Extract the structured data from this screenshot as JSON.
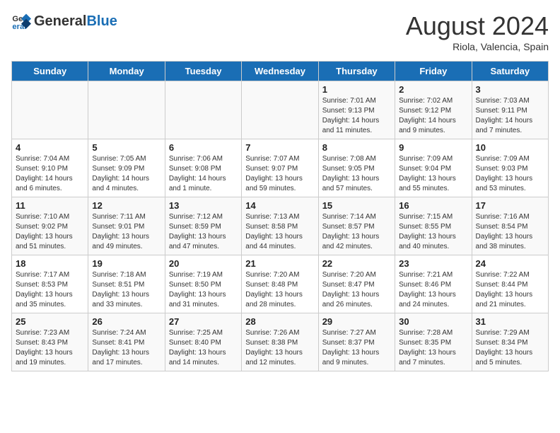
{
  "header": {
    "logo_general": "General",
    "logo_blue": "Blue",
    "month": "August 2024",
    "location": "Riola, Valencia, Spain"
  },
  "weekdays": [
    "Sunday",
    "Monday",
    "Tuesday",
    "Wednesday",
    "Thursday",
    "Friday",
    "Saturday"
  ],
  "weeks": [
    [
      {
        "day": "",
        "info": ""
      },
      {
        "day": "",
        "info": ""
      },
      {
        "day": "",
        "info": ""
      },
      {
        "day": "",
        "info": ""
      },
      {
        "day": "1",
        "info": "Sunrise: 7:01 AM\nSunset: 9:13 PM\nDaylight: 14 hours\nand 11 minutes."
      },
      {
        "day": "2",
        "info": "Sunrise: 7:02 AM\nSunset: 9:12 PM\nDaylight: 14 hours\nand 9 minutes."
      },
      {
        "day": "3",
        "info": "Sunrise: 7:03 AM\nSunset: 9:11 PM\nDaylight: 14 hours\nand 7 minutes."
      }
    ],
    [
      {
        "day": "4",
        "info": "Sunrise: 7:04 AM\nSunset: 9:10 PM\nDaylight: 14 hours\nand 6 minutes."
      },
      {
        "day": "5",
        "info": "Sunrise: 7:05 AM\nSunset: 9:09 PM\nDaylight: 14 hours\nand 4 minutes."
      },
      {
        "day": "6",
        "info": "Sunrise: 7:06 AM\nSunset: 9:08 PM\nDaylight: 14 hours\nand 1 minute."
      },
      {
        "day": "7",
        "info": "Sunrise: 7:07 AM\nSunset: 9:07 PM\nDaylight: 13 hours\nand 59 minutes."
      },
      {
        "day": "8",
        "info": "Sunrise: 7:08 AM\nSunset: 9:05 PM\nDaylight: 13 hours\nand 57 minutes."
      },
      {
        "day": "9",
        "info": "Sunrise: 7:09 AM\nSunset: 9:04 PM\nDaylight: 13 hours\nand 55 minutes."
      },
      {
        "day": "10",
        "info": "Sunrise: 7:09 AM\nSunset: 9:03 PM\nDaylight: 13 hours\nand 53 minutes."
      }
    ],
    [
      {
        "day": "11",
        "info": "Sunrise: 7:10 AM\nSunset: 9:02 PM\nDaylight: 13 hours\nand 51 minutes."
      },
      {
        "day": "12",
        "info": "Sunrise: 7:11 AM\nSunset: 9:01 PM\nDaylight: 13 hours\nand 49 minutes."
      },
      {
        "day": "13",
        "info": "Sunrise: 7:12 AM\nSunset: 8:59 PM\nDaylight: 13 hours\nand 47 minutes."
      },
      {
        "day": "14",
        "info": "Sunrise: 7:13 AM\nSunset: 8:58 PM\nDaylight: 13 hours\nand 44 minutes."
      },
      {
        "day": "15",
        "info": "Sunrise: 7:14 AM\nSunset: 8:57 PM\nDaylight: 13 hours\nand 42 minutes."
      },
      {
        "day": "16",
        "info": "Sunrise: 7:15 AM\nSunset: 8:55 PM\nDaylight: 13 hours\nand 40 minutes."
      },
      {
        "day": "17",
        "info": "Sunrise: 7:16 AM\nSunset: 8:54 PM\nDaylight: 13 hours\nand 38 minutes."
      }
    ],
    [
      {
        "day": "18",
        "info": "Sunrise: 7:17 AM\nSunset: 8:53 PM\nDaylight: 13 hours\nand 35 minutes."
      },
      {
        "day": "19",
        "info": "Sunrise: 7:18 AM\nSunset: 8:51 PM\nDaylight: 13 hours\nand 33 minutes."
      },
      {
        "day": "20",
        "info": "Sunrise: 7:19 AM\nSunset: 8:50 PM\nDaylight: 13 hours\nand 31 minutes."
      },
      {
        "day": "21",
        "info": "Sunrise: 7:20 AM\nSunset: 8:48 PM\nDaylight: 13 hours\nand 28 minutes."
      },
      {
        "day": "22",
        "info": "Sunrise: 7:20 AM\nSunset: 8:47 PM\nDaylight: 13 hours\nand 26 minutes."
      },
      {
        "day": "23",
        "info": "Sunrise: 7:21 AM\nSunset: 8:46 PM\nDaylight: 13 hours\nand 24 minutes."
      },
      {
        "day": "24",
        "info": "Sunrise: 7:22 AM\nSunset: 8:44 PM\nDaylight: 13 hours\nand 21 minutes."
      }
    ],
    [
      {
        "day": "25",
        "info": "Sunrise: 7:23 AM\nSunset: 8:43 PM\nDaylight: 13 hours\nand 19 minutes."
      },
      {
        "day": "26",
        "info": "Sunrise: 7:24 AM\nSunset: 8:41 PM\nDaylight: 13 hours\nand 17 minutes."
      },
      {
        "day": "27",
        "info": "Sunrise: 7:25 AM\nSunset: 8:40 PM\nDaylight: 13 hours\nand 14 minutes."
      },
      {
        "day": "28",
        "info": "Sunrise: 7:26 AM\nSunset: 8:38 PM\nDaylight: 13 hours\nand 12 minutes."
      },
      {
        "day": "29",
        "info": "Sunrise: 7:27 AM\nSunset: 8:37 PM\nDaylight: 13 hours\nand 9 minutes."
      },
      {
        "day": "30",
        "info": "Sunrise: 7:28 AM\nSunset: 8:35 PM\nDaylight: 13 hours\nand 7 minutes."
      },
      {
        "day": "31",
        "info": "Sunrise: 7:29 AM\nSunset: 8:34 PM\nDaylight: 13 hours\nand 5 minutes."
      }
    ]
  ]
}
